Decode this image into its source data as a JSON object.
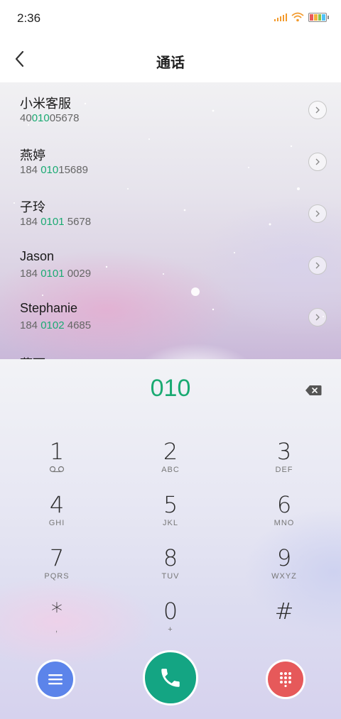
{
  "status_bar": {
    "time": "2:36"
  },
  "header": {
    "title": "通话",
    "back_icon": "back-arrow-icon"
  },
  "contacts": [
    {
      "name": "小米客服",
      "number_pre": "40",
      "number_match": "010",
      "number_post": "05678"
    },
    {
      "name": "燕婷",
      "number_pre": "184 ",
      "number_match": "010",
      "number_post": "15689"
    },
    {
      "name": "子玲",
      "number_pre": "184 ",
      "number_match": "0101",
      "number_post": " 5678"
    },
    {
      "name": "Jason",
      "number_pre": "184 ",
      "number_match": "0101",
      "number_post": " 0029"
    },
    {
      "name": "Stephanie",
      "number_pre": "184 ",
      "number_match": "0102",
      "number_post": " 4685"
    }
  ],
  "partial_contact": "燕丽",
  "dialer": {
    "input_value": "010",
    "keys": [
      {
        "digit": "1",
        "letters": "voicemail"
      },
      {
        "digit": "2",
        "letters": "ABC"
      },
      {
        "digit": "3",
        "letters": "DEF"
      },
      {
        "digit": "4",
        "letters": "GHI"
      },
      {
        "digit": "5",
        "letters": "JKL"
      },
      {
        "digit": "6",
        "letters": "MNO"
      },
      {
        "digit": "7",
        "letters": "PQRS"
      },
      {
        "digit": "8",
        "letters": "TUV"
      },
      {
        "digit": "9",
        "letters": "WXYZ"
      },
      {
        "digit": "*",
        "letters": ","
      },
      {
        "digit": "0",
        "letters": "+"
      },
      {
        "digit": "#",
        "letters": ""
      }
    ]
  },
  "colors": {
    "accent_green": "#1aaa72",
    "menu_button": "#5c84ea",
    "call_button": "#14a583",
    "dialpad_button": "#e6595a"
  }
}
